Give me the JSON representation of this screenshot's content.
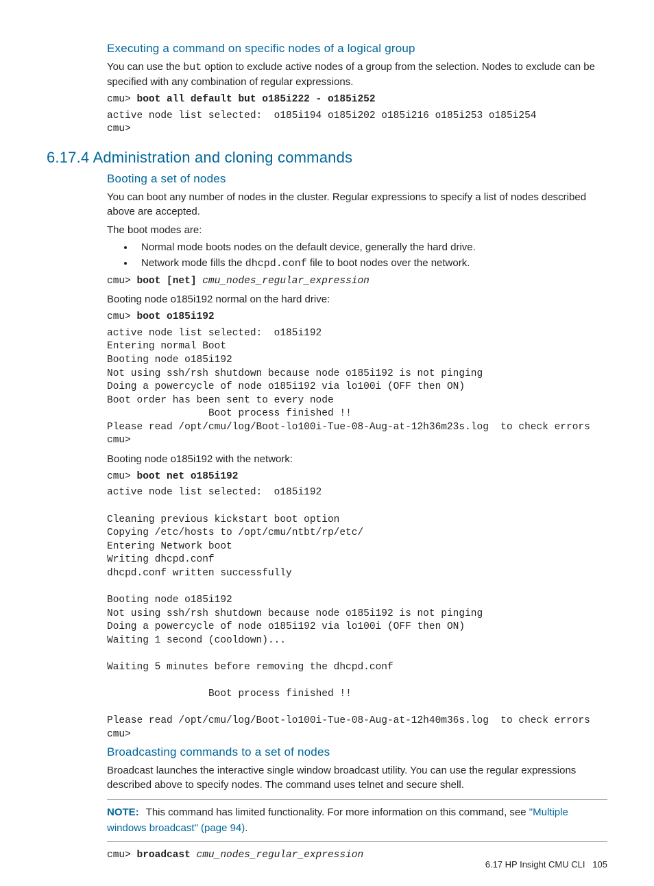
{
  "s1": {
    "heading": "Executing a command on specific nodes of a logical group",
    "p1a": "You can use the ",
    "p1code": "but",
    "p1b": " option to exclude active nodes of a group from the selection. Nodes to exclude can be specified with any combination of regular expressions.",
    "code1_prompt": "cmu> ",
    "code1_cmd": "boot all default but o185i222 - o185i252",
    "code1_out": "active node list selected:  o185i194 o185i202 o185i216 o185i253 o185i254\ncmu>"
  },
  "s2": {
    "heading": "6.17.4 Administration and cloning commands"
  },
  "s3": {
    "heading": "Booting a set of nodes",
    "p1": "You can boot any number of nodes in the cluster. Regular expressions to specify a list of nodes described above are accepted.",
    "p2": "The boot modes are:",
    "li1": "Normal mode boots nodes on the default device, generally the hard drive.",
    "li2a": "Network mode fills the ",
    "li2code": "dhcpd.conf",
    "li2b": " file to boot nodes over the network.",
    "code1_prompt": "cmu> ",
    "code1_cmd": "boot [net] ",
    "code1_arg": "cmu_nodes_regular_expression",
    "p3": "Booting node o185i192 normal on the hard drive:",
    "code2_prompt": "cmu> ",
    "code2_cmd": "boot o185i192",
    "code2_out": "active node list selected:  o185i192\nEntering normal Boot\nBooting node o185i192\nNot using ssh/rsh shutdown because node o185i192 is not pinging\nDoing a powercycle of node o185i192 via lo100i (OFF then ON)\nBoot order has been sent to every node\n                 Boot process finished !!\nPlease read /opt/cmu/log/Boot-lo100i-Tue-08-Aug-at-12h36m23s.log  to check errors\ncmu>",
    "p4": "Booting node o185i192 with the network:",
    "code3_prompt": "cmu> ",
    "code3_cmd": "boot net o185i192",
    "code3_out": "active node list selected:  o185i192\n\nCleaning previous kickstart boot option\nCopying /etc/hosts to /opt/cmu/ntbt/rp/etc/\nEntering Network boot\nWriting dhcpd.conf\ndhcpd.conf written successfully\n\nBooting node o185i192\nNot using ssh/rsh shutdown because node o185i192 is not pinging\nDoing a powercycle of node o185i192 via lo100i (OFF then ON)\nWaiting 1 second (cooldown)...\n\nWaiting 5 minutes before removing the dhcpd.conf\n\n                 Boot process finished !!\n\nPlease read /opt/cmu/log/Boot-lo100i-Tue-08-Aug-at-12h40m36s.log  to check errors\ncmu>"
  },
  "s4": {
    "heading": "Broadcasting commands to a set of nodes",
    "p1": "Broadcast launches the interactive single window broadcast utility. You can use the regular expressions described above to specify nodes. The command uses telnet and secure shell.",
    "note_label": "NOTE:",
    "note_a": "This command has limited functionality. For more information on this command, see ",
    "note_link": "\"Multiple windows broadcast\" (page 94)",
    "note_b": ".",
    "code1_prompt": "cmu> ",
    "code1_cmd": "broadcast ",
    "code1_arg": "cmu_nodes_regular_expression"
  },
  "footer": {
    "text": "6.17 HP Insight CMU CLI",
    "page": "105"
  }
}
